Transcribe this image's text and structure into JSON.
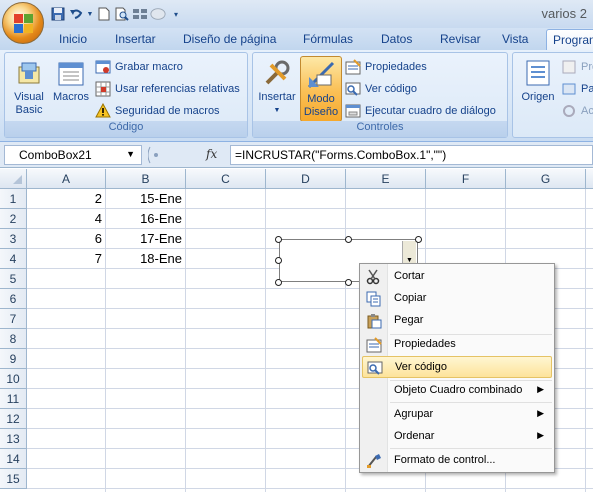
{
  "window": {
    "title": "varios 2"
  },
  "qat": {
    "icons": [
      "save-icon",
      "undo-icon",
      "new-icon",
      "print-preview-icon",
      "grid-icon",
      "circle-icon",
      "customize-icon"
    ]
  },
  "tabs": [
    "Inicio",
    "Insertar",
    "Diseño de página",
    "Fórmulas",
    "Datos",
    "Revisar",
    "Vista",
    "Programador"
  ],
  "active_tab": "Programador",
  "ribbon": {
    "codigo": {
      "label": "Código",
      "visual_basic": "Visual Basic",
      "visual_basic_l1": "Visual",
      "visual_basic_l2": "Basic",
      "macros": "Macros",
      "grabar_macro": "Grabar macro",
      "usar_referencias": "Usar referencias relativas",
      "seguridad": "Seguridad de macros"
    },
    "controles": {
      "label": "Controles",
      "insertar": "Insertar",
      "modo_l1": "Modo",
      "modo_l2": "Diseño",
      "propiedades": "Propiedades",
      "ver_codigo": "Ver código",
      "ejecutar": "Ejecutar cuadro de diálogo"
    },
    "xml": {
      "origen": "Origen",
      "pro": "Pro",
      "pa": "Pa",
      "ac": "Ac"
    }
  },
  "formula_bar": {
    "name_box": "ComboBox21",
    "fx": "fx",
    "formula": "=INCRUSTAR(\"Forms.ComboBox.1\",\"\")"
  },
  "grid": {
    "columns": [
      "A",
      "B",
      "C",
      "D",
      "E",
      "F",
      "G"
    ],
    "rows": [
      "1",
      "2",
      "3",
      "4",
      "5",
      "6",
      "7",
      "8",
      "9",
      "10",
      "11",
      "12",
      "13",
      "14",
      "15"
    ],
    "cells": {
      "A1": "2",
      "B1": "15-Ene",
      "A2": "4",
      "B2": "16-Ene",
      "A3": "6",
      "B3": "17-Ene",
      "A4": "7",
      "B4": "18-Ene"
    }
  },
  "context_menu": {
    "cortar": "Cortar",
    "copiar": "Copiar",
    "pegar": "Pegar",
    "propiedades": "Propiedades",
    "ver_codigo": "Ver código",
    "objeto": "Objeto Cuadro combinado",
    "agrupar": "Agrupar",
    "ordenar": "Ordenar",
    "formato": "Formato de control..."
  },
  "colors": {
    "accent": "#15428b",
    "highlight": "#fde39a",
    "modo_active": "#fbc25a"
  }
}
